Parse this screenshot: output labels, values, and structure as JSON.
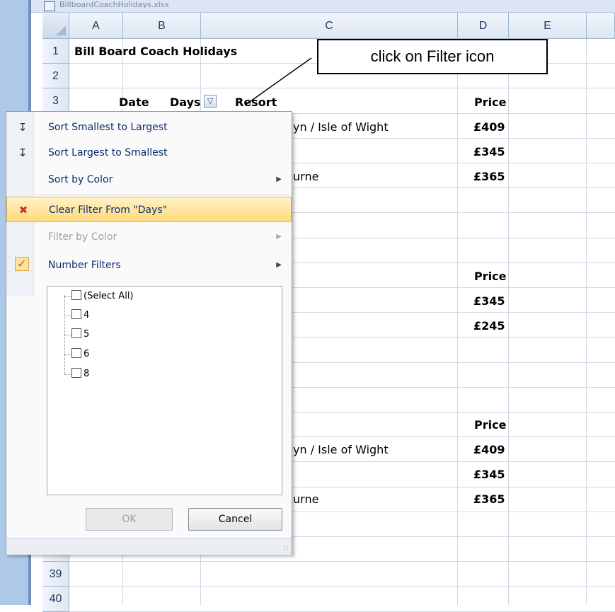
{
  "window": {
    "file_title": "BillboardCoachHolidays.xlsx"
  },
  "columns": [
    "A",
    "B",
    "C",
    "D",
    "E"
  ],
  "rows": [
    {
      "num": "1",
      "a": "Bill Board Coach Holidays",
      "b": "",
      "c": "",
      "d": ""
    },
    {
      "num": "2",
      "a": "",
      "b": "",
      "c": "",
      "d": ""
    },
    {
      "num": "3",
      "a": "Date",
      "b": "Days",
      "c": "Resort",
      "d": "Price"
    },
    {
      "num": "",
      "c": "yn / Isle of Wight",
      "d": "£409"
    },
    {
      "num": "",
      "c": "",
      "d": "£345"
    },
    {
      "num": "",
      "c": "urne",
      "d": "£365"
    },
    {
      "num": "",
      "c": "",
      "d": ""
    },
    {
      "num": "",
      "c": "",
      "d": ""
    },
    {
      "num": "",
      "c": "",
      "d": ""
    },
    {
      "num": "",
      "c": "",
      "d": "Price"
    },
    {
      "num": "",
      "c": "",
      "d": "£345"
    },
    {
      "num": "",
      "c": "",
      "d": "£245"
    },
    {
      "num": "",
      "c": "",
      "d": ""
    },
    {
      "num": "",
      "c": "",
      "d": ""
    },
    {
      "num": "",
      "c": "",
      "d": ""
    },
    {
      "num": "",
      "c": "",
      "d": "Price"
    },
    {
      "num": "",
      "c": "yn / Isle of Wight",
      "d": "£409"
    },
    {
      "num": "",
      "c": "",
      "d": "£345"
    },
    {
      "num": "",
      "c": "urne",
      "d": "£365"
    },
    {
      "num": "",
      "c": "",
      "d": ""
    },
    {
      "num": "",
      "c": "",
      "d": ""
    },
    {
      "num": "39",
      "c": "",
      "d": ""
    },
    {
      "num": "40",
      "c": "",
      "d": ""
    }
  ],
  "callout": {
    "text": "click on Filter icon"
  },
  "filter_menu": {
    "sort_asc": "Sort Smallest to Largest",
    "sort_desc": "Sort Largest to Smallest",
    "sort_color": "Sort by Color",
    "clear_filter": "Clear Filter From \"Days\"",
    "filter_color": "Filter by Color",
    "number_filters": "Number Filters",
    "values": [
      "(Select All)",
      "4",
      "5",
      "6",
      "8"
    ],
    "ok": "OK",
    "cancel": "Cancel"
  }
}
